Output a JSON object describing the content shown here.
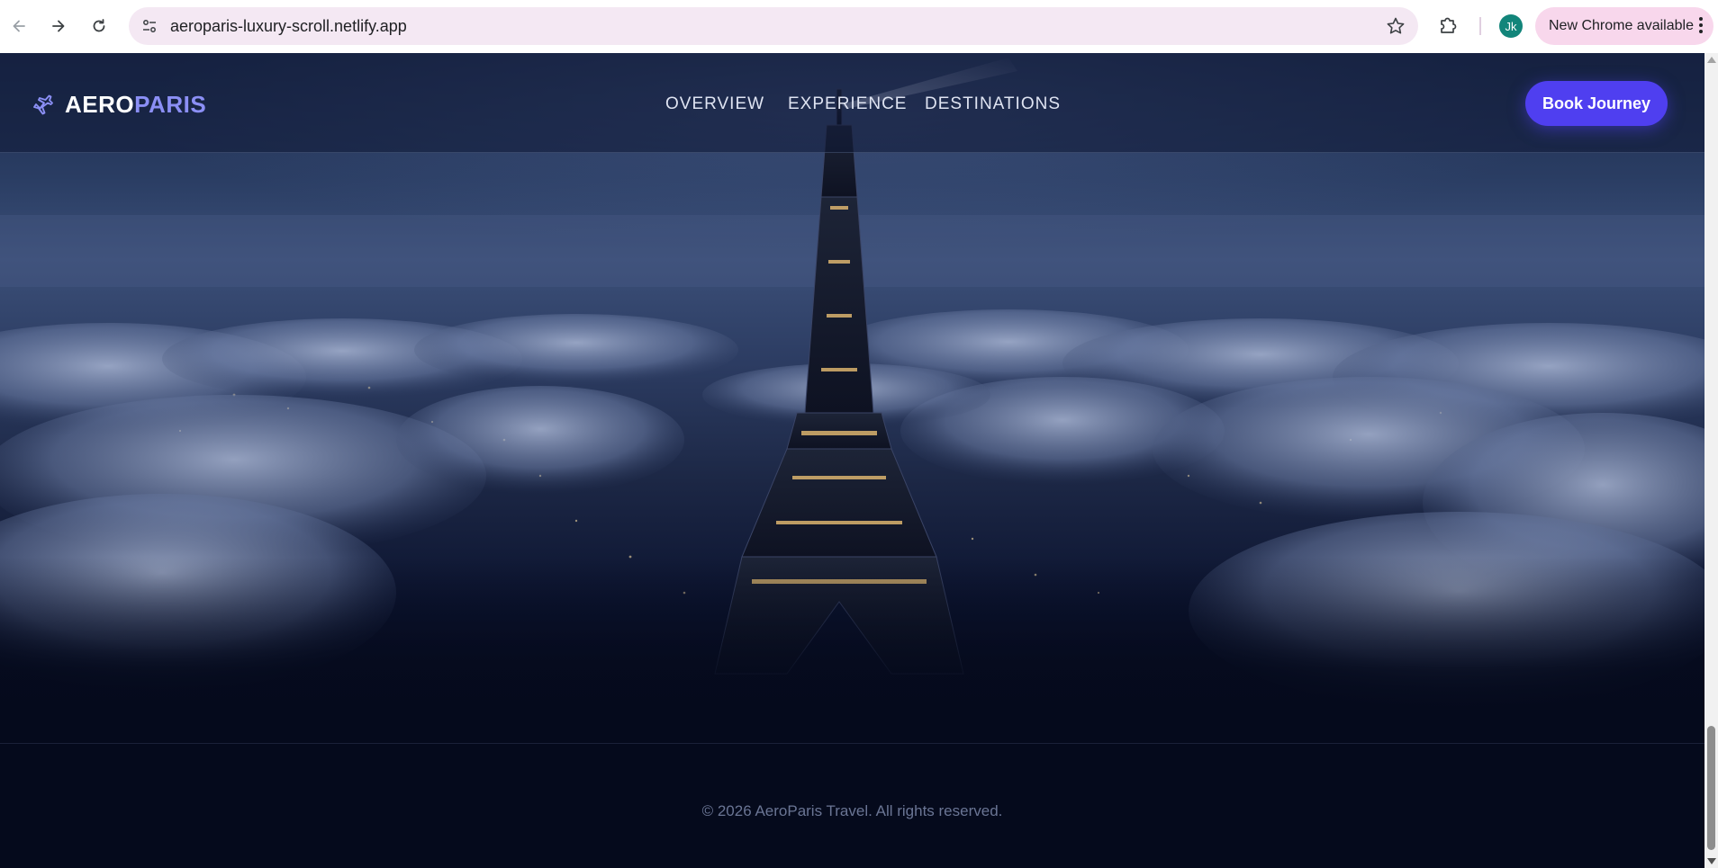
{
  "browser": {
    "url": "aeroparis-luxury-scroll.netlify.app",
    "profile_initials": "Jk",
    "update_label": "New Chrome available"
  },
  "site": {
    "logo": {
      "part1": "AERO",
      "part2": "PARIS",
      "icon": "plane-icon"
    },
    "nav": [
      {
        "label": "OVERVIEW"
      },
      {
        "label": "EXPERIENCE"
      },
      {
        "label": "DESTINATIONS"
      }
    ],
    "cta_label": "Book Journey",
    "footer_text": "© 2026 AeroParis Travel. All rights reserved."
  },
  "colors": {
    "accent": "#8b8ff5",
    "button": "#4f3ff0",
    "background": "#050a1c"
  }
}
